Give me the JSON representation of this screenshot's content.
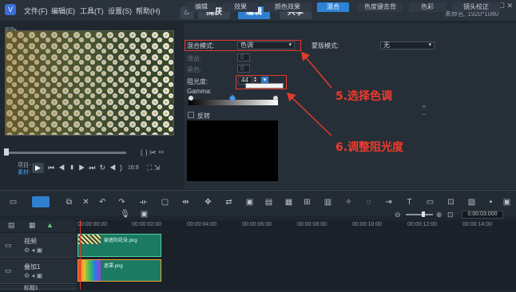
{
  "menu": [
    "文件(F)",
    "编辑(E)",
    "工具(T)",
    "设置(S)",
    "帮助(H)"
  ],
  "workspace_tabs": {
    "home_icon": "home-icon",
    "capture": "捕获",
    "edit": "编辑",
    "share": "共享"
  },
  "project_info": "未命名, 1920*1080",
  "preview": {
    "tag": "项目▸",
    "project_label": "项目-",
    "material_label": "素材-",
    "aspect": "16:9"
  },
  "options_tabs": [
    "编辑",
    "效果",
    "颜色效果",
    "混合",
    "色度键去背",
    "色彩",
    "镜头校正"
  ],
  "blend": {
    "mode_label": "混合模式:",
    "mode_value": "色调",
    "gain_label": "增益:",
    "gain_value": "0",
    "black_label": "黑色:",
    "black_value": "0",
    "opacity_label": "阻光度:",
    "opacity_value": "44",
    "gamma_label": "Gamma:",
    "invert_label": "反转",
    "mask_label": "蒙版模式:",
    "mask_value": "无"
  },
  "annotations": {
    "step5": "5.选择色调",
    "step6": "6.调整阻光度"
  },
  "zoom_time": "0:00:03:000",
  "ruler_ticks": [
    "00:00:00:00",
    "00:00:02:00",
    "00:00:04:00",
    "00:00:06:00",
    "00:00:08:00",
    "00:00:10:00",
    "00:00:12:00",
    "00:00:14:00"
  ],
  "tracks": [
    {
      "label": "视频",
      "clip": "被遮阳花朵.png"
    },
    {
      "label": "叠加1",
      "clip": "遮罩.png"
    },
    {
      "label": "标题1",
      "clip": ""
    }
  ]
}
